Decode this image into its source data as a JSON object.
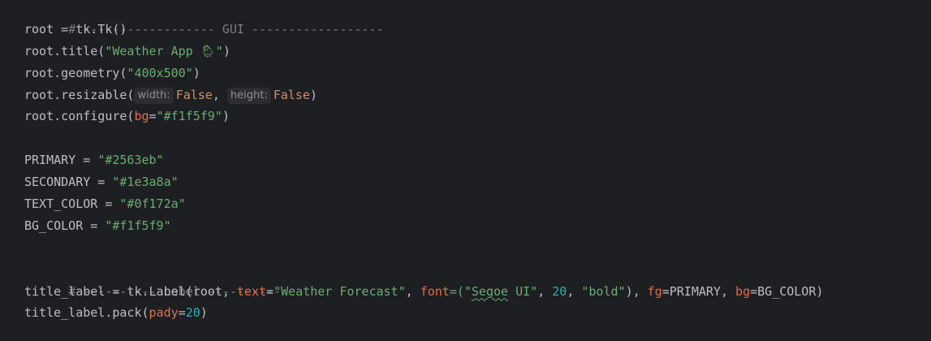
{
  "lines": [
    {
      "comment": "# ------------------ GUI ------------------"
    },
    {
      "var": "root",
      "op": " = ",
      "call": "tk.Tk()"
    },
    {
      "pre": "root.title(",
      "str": "\"Weather App 🌦\"",
      "post": ")"
    },
    {
      "pre": "root.geometry(",
      "str": "\"400x500\"",
      "post": ")"
    },
    {
      "pre": "root.resizable(",
      "hint1": "width:",
      "val1": "False",
      "sep": ", ",
      "hint2": "height:",
      "val2": "False",
      "post": ")"
    },
    {
      "pre": "root.configure(",
      "param": "bg",
      "eq": "=",
      "str": "\"#f1f5f9\"",
      "post": ")"
    },
    {
      "blank": ""
    },
    {
      "var": "PRIMARY",
      "op": " = ",
      "str": "\"#2563eb\""
    },
    {
      "var": "SECONDARY",
      "op": " = ",
      "str": "\"#1e3a8a\""
    },
    {
      "var": "TEXT_COLOR",
      "op": " = ",
      "str": "\"#0f172a\""
    },
    {
      "var": "BG_COLOR",
      "op": " = ",
      "str": "\"#f1f5f9\""
    },
    {
      "blank": ""
    },
    {
      "comment": "# ---------- Label ----------"
    },
    {
      "a": "title_label = tk.Label(root, ",
      "p_text": "text",
      "eq1": "=",
      "s_text": "\"Weather Forecast\"",
      "c1": ", ",
      "p_font": "font",
      "eq2": "=(\"",
      "s_font1": "Segoe",
      "s_font2": " UI\"",
      "c2": ", ",
      "n_size": "20",
      "c3": ", ",
      "s_bold": "\"bold\"",
      "c4": "), ",
      "p_fg": "fg",
      "eq3": "=PRIMARY, ",
      "p_bg": "bg",
      "eq4": "=BG_COLOR)"
    },
    {
      "pre": "title_label.pack(",
      "param": "pady",
      "eq": "=",
      "num": "20",
      "post": ")"
    }
  ],
  "colors": {
    "background": "#1e1f22",
    "text": "#bcbec4",
    "comment": "#7a7e85",
    "string": "#6aab73",
    "number": "#2aacb8",
    "keyword": "#cf8e6d",
    "named_param": "#e06c4b"
  }
}
